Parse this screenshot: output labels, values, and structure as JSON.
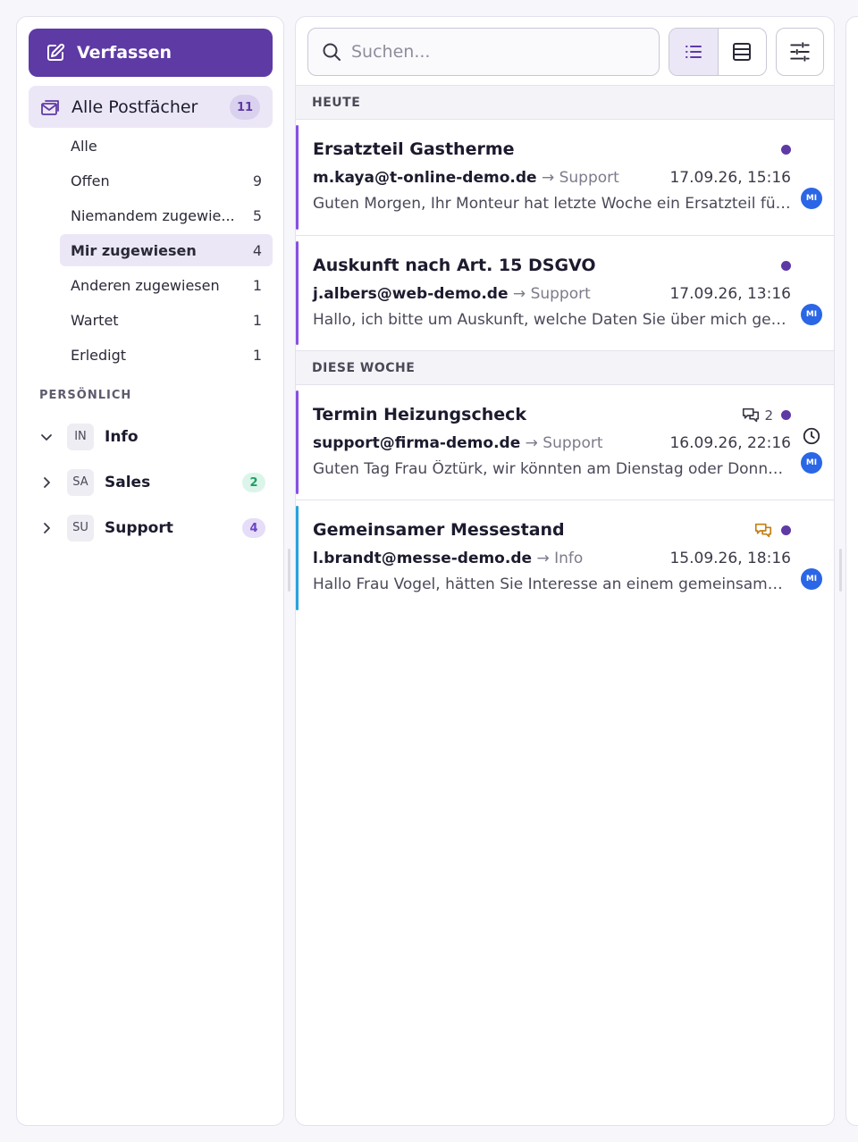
{
  "sidebar": {
    "compose_label": "Verfassen",
    "all_mailboxes": {
      "label": "Alle Postfächer",
      "count": "11"
    },
    "filters": [
      {
        "label": "Alle",
        "count": ""
      },
      {
        "label": "Offen",
        "count": "9"
      },
      {
        "label": "Niemandem zugewie...",
        "count": "5"
      },
      {
        "label": "Mir zugewiesen",
        "count": "4",
        "active": true
      },
      {
        "label": "Anderen zugewiesen",
        "count": "1"
      },
      {
        "label": "Wartet",
        "count": "1"
      },
      {
        "label": "Erledigt",
        "count": "1"
      }
    ],
    "personal_label": "PERSÖNLICH",
    "inboxes": [
      {
        "abbr": "IN",
        "name": "Info",
        "count": "",
        "expanded": true
      },
      {
        "abbr": "SA",
        "name": "Sales",
        "count": "2",
        "expanded": false
      },
      {
        "abbr": "SU",
        "name": "Support",
        "count": "4",
        "expanded": false
      }
    ]
  },
  "toolbar": {
    "search_placeholder": "Suchen..."
  },
  "groups": [
    {
      "label": "HEUTE"
    },
    {
      "label": "DIESE WOCHE"
    }
  ],
  "messages": [
    {
      "subject": "Ersatzteil Gastherme",
      "from": "m.kaya@t-online-demo.de",
      "arrow": "→",
      "mailbox": "Support",
      "date": "17.09.26, 15:16",
      "preview": "Guten Morgen, Ihr Monteur hat letzte Woche ein Ersatzteil für die Gastherme bestellt",
      "assignee": "MI",
      "comments": ""
    },
    {
      "subject": "Auskunft nach Art. 15 DSGVO",
      "from": "j.albers@web-demo.de",
      "arrow": "→",
      "mailbox": "Support",
      "date": "17.09.26, 13:16",
      "preview": "Hallo, ich bitte um Auskunft, welche Daten Sie über mich gespeichert haben",
      "assignee": "MI",
      "comments": ""
    },
    {
      "subject": "Termin Heizungscheck",
      "from": "support@firma-demo.de",
      "arrow": "→",
      "mailbox": "Support",
      "date": "16.09.26, 22:16",
      "preview": "Guten Tag Frau Öztürk, wir könnten am Dienstag oder Donnerstag vorbeikommen",
      "assignee": "MI",
      "comments": "2"
    },
    {
      "subject": "Gemeinsamer Messestand",
      "from": "l.brandt@messe-demo.de",
      "arrow": "→",
      "mailbox": "Info",
      "date": "15.09.26, 18:16",
      "preview": "Hallo Frau Vogel, hätten Sie Interesse an einem gemeinsamen Messestand",
      "assignee": "MI",
      "comments": ""
    }
  ],
  "colors": {
    "accent": "#5e3aa5",
    "accent_light": "#ece7f7",
    "support_bar": "#8a4fe0",
    "info_bar": "#27a3dd",
    "comment_amber": "#c47f14",
    "sales_badge_bg": "#dcf5ea",
    "sales_badge_fg": "#1f9e63",
    "support_badge_bg": "#e6ddf8",
    "support_badge_fg": "#6b45c4",
    "avatar_blue": "#2a66e6"
  }
}
